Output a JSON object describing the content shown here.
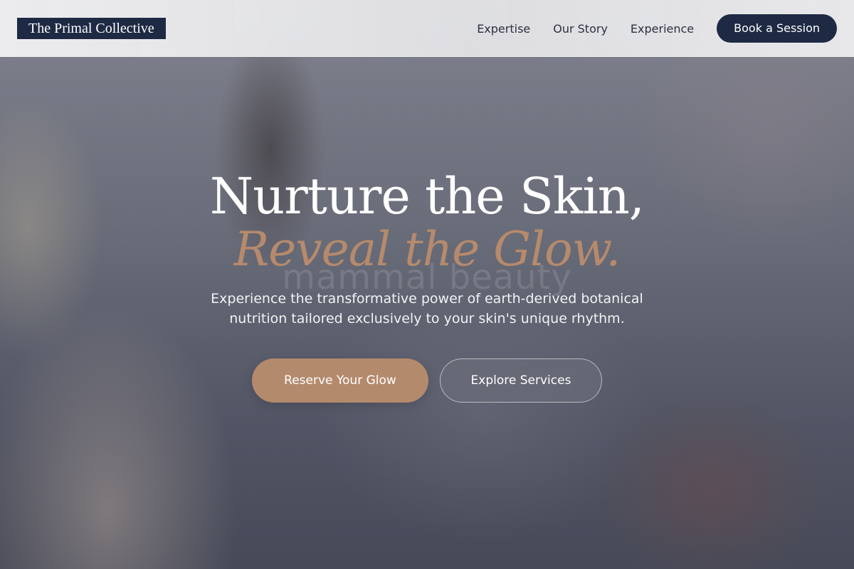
{
  "header": {
    "logo": "The Primal Collective",
    "nav": {
      "expertise": "Expertise",
      "our_story": "Our Story",
      "experience": "Experience",
      "cta": "Book a Session"
    }
  },
  "hero": {
    "watermark": "mammal beauty",
    "headline_line1": "Nurture the Skin,",
    "headline_line2": "Reveal the Glow.",
    "subtext": "Experience the transformative power of earth-derived botanical nutrition tailored exclusively to your skin's unique rhythm.",
    "primary_cta": "Reserve Your Glow",
    "secondary_cta": "Explore Services"
  },
  "colors": {
    "navy": "#1e2a44",
    "accent": "#b48a6d"
  }
}
